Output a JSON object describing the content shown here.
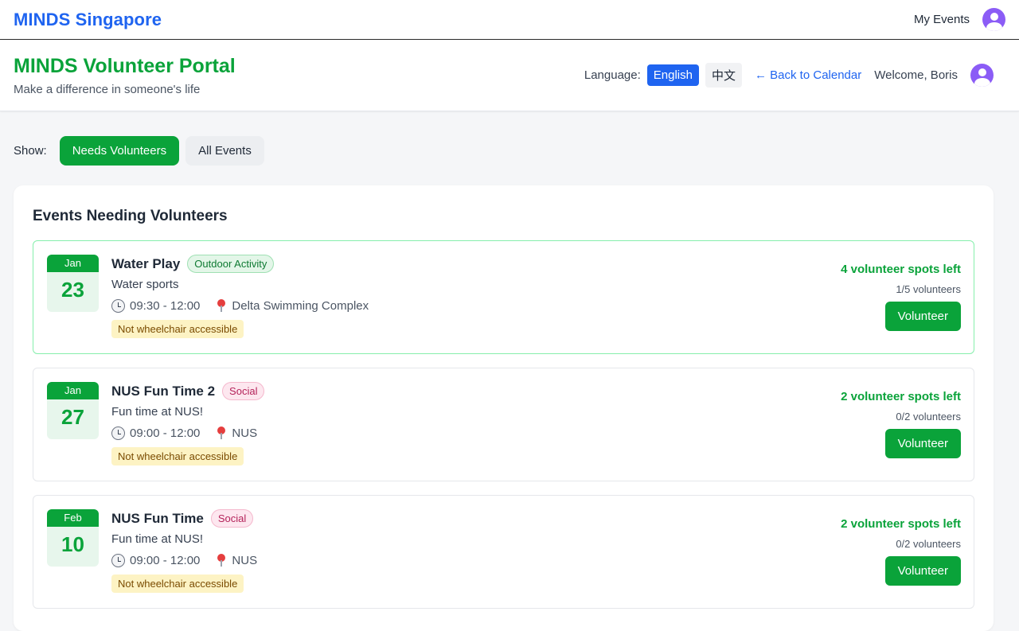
{
  "nav": {
    "brand": "MINDS Singapore",
    "my_events": "My Events"
  },
  "header": {
    "title": "MINDS Volunteer Portal",
    "subtitle": "Make a difference in someone's life",
    "language_label": "Language:",
    "lang_english": "English",
    "lang_chinese": "中文",
    "back_link": "← Back to Calendar",
    "welcome": "Welcome, Boris"
  },
  "filter": {
    "label": "Show:",
    "needs_volunteers": "Needs Volunteers",
    "all_events": "All Events"
  },
  "events_section": {
    "title": "Events Needing Volunteers",
    "events": [
      {
        "month": "Jan",
        "day": "23",
        "title": "Water Play",
        "tag": "Outdoor Activity",
        "tag_type": "outdoor",
        "description": "Water sports",
        "time": "09:30 - 12:00",
        "location": "Delta Swimming Complex",
        "accessibility": "Not wheelchair accessible",
        "spots_left": "4 volunteer spots left",
        "volunteer_count": "1/5 volunteers",
        "button": "Volunteer"
      },
      {
        "month": "Jan",
        "day": "27",
        "title": "NUS Fun Time 2",
        "tag": "Social",
        "tag_type": "social",
        "description": "Fun time at NUS!",
        "time": "09:00 - 12:00",
        "location": "NUS",
        "accessibility": "Not wheelchair accessible",
        "spots_left": "2 volunteer spots left",
        "volunteer_count": "0/2 volunteers",
        "button": "Volunteer"
      },
      {
        "month": "Feb",
        "day": "10",
        "title": "NUS Fun Time",
        "tag": "Social",
        "tag_type": "social",
        "description": "Fun time at NUS!",
        "time": "09:00 - 12:00",
        "location": "NUS",
        "accessibility": "Not wheelchair accessible",
        "spots_left": "2 volunteer spots left",
        "volunteer_count": "0/2 volunteers",
        "button": "Volunteer"
      }
    ]
  },
  "icons": {
    "user": "user-avatar-icon",
    "clock": "clock-icon",
    "location": "map-pin-icon"
  },
  "colors": {
    "brand_blue": "#1f64f0",
    "green": "#0aa33a",
    "avatar_purple": "#8b5cf6"
  }
}
